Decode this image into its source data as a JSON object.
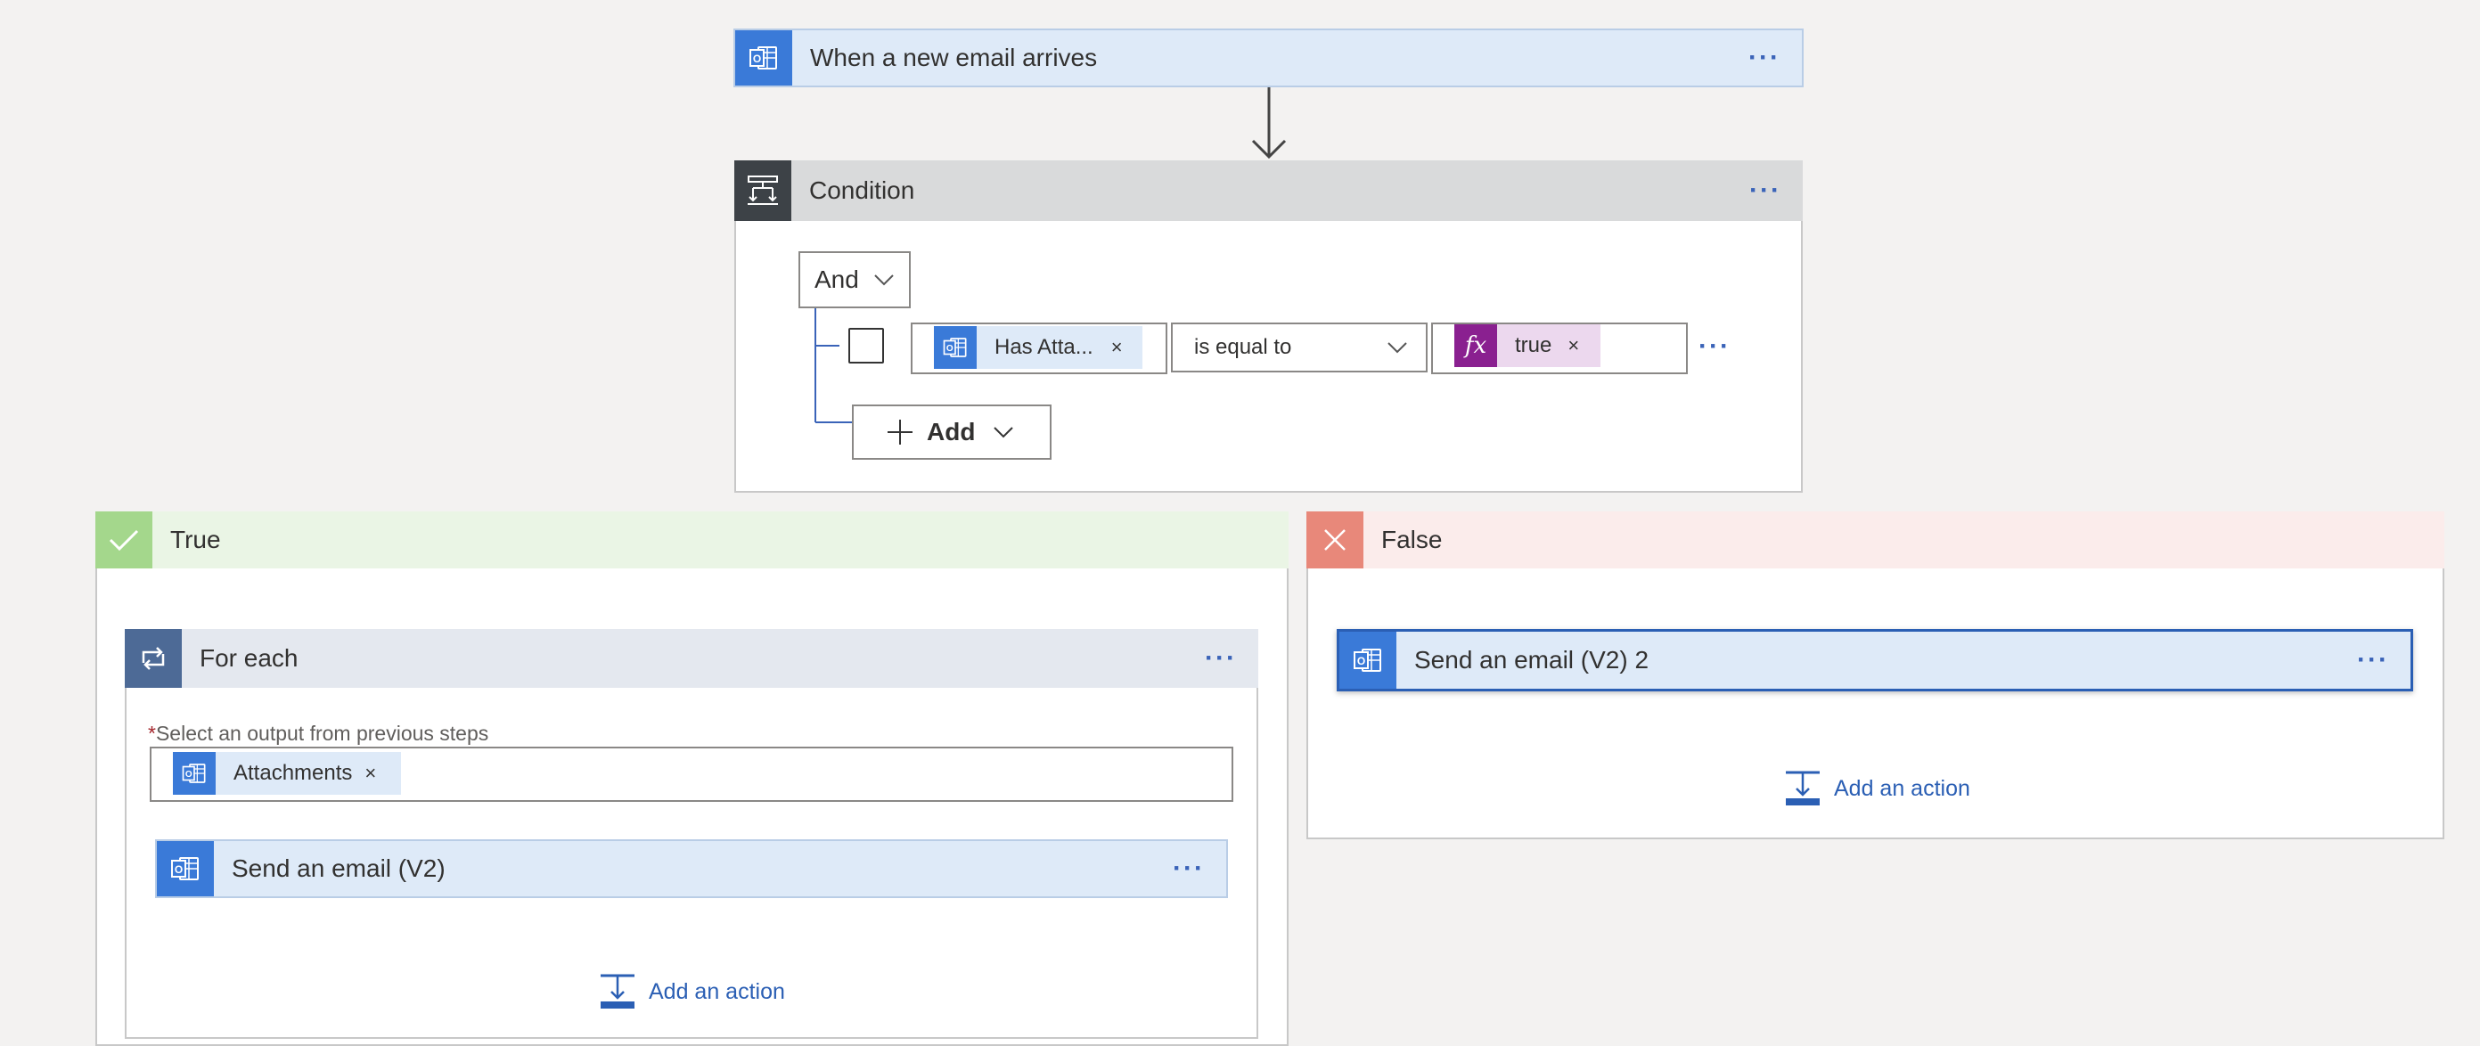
{
  "trigger": {
    "title": "When a new email arrives",
    "icon": "outlook-icon",
    "more": "···"
  },
  "condition": {
    "title": "Condition",
    "more": "···",
    "group_operator": "And",
    "row": {
      "left_token": "Has Atta...",
      "token_remove": "×",
      "operator": "is equal to",
      "right_token": "true",
      "fx_label": "fx",
      "row_more": "···"
    },
    "add_label": "Add"
  },
  "true_branch": {
    "label": "True",
    "accent": "#a4d78c",
    "foreach": {
      "title": "For each",
      "more": "···",
      "required_mark": "*",
      "field_label": "Select an output from previous steps",
      "token": "Attachments",
      "token_remove": "×",
      "action_title": "Send an email (V2)",
      "action_more": "···",
      "add_action": "Add an action"
    }
  },
  "false_branch": {
    "label": "False",
    "accent": "#e8887a",
    "action_title": "Send an email (V2) 2",
    "action_more": "···",
    "add_action": "Add an action"
  },
  "colors": {
    "outlook_blue": "#3a7ad8",
    "action_header": "#deeaf8",
    "condition_header": "#d9dadb",
    "condition_icon_bg": "#3d4247",
    "foreach_icon_bg": "#4d6a96",
    "fx_purple": "#8a2090",
    "link": "#2b5fb4"
  }
}
